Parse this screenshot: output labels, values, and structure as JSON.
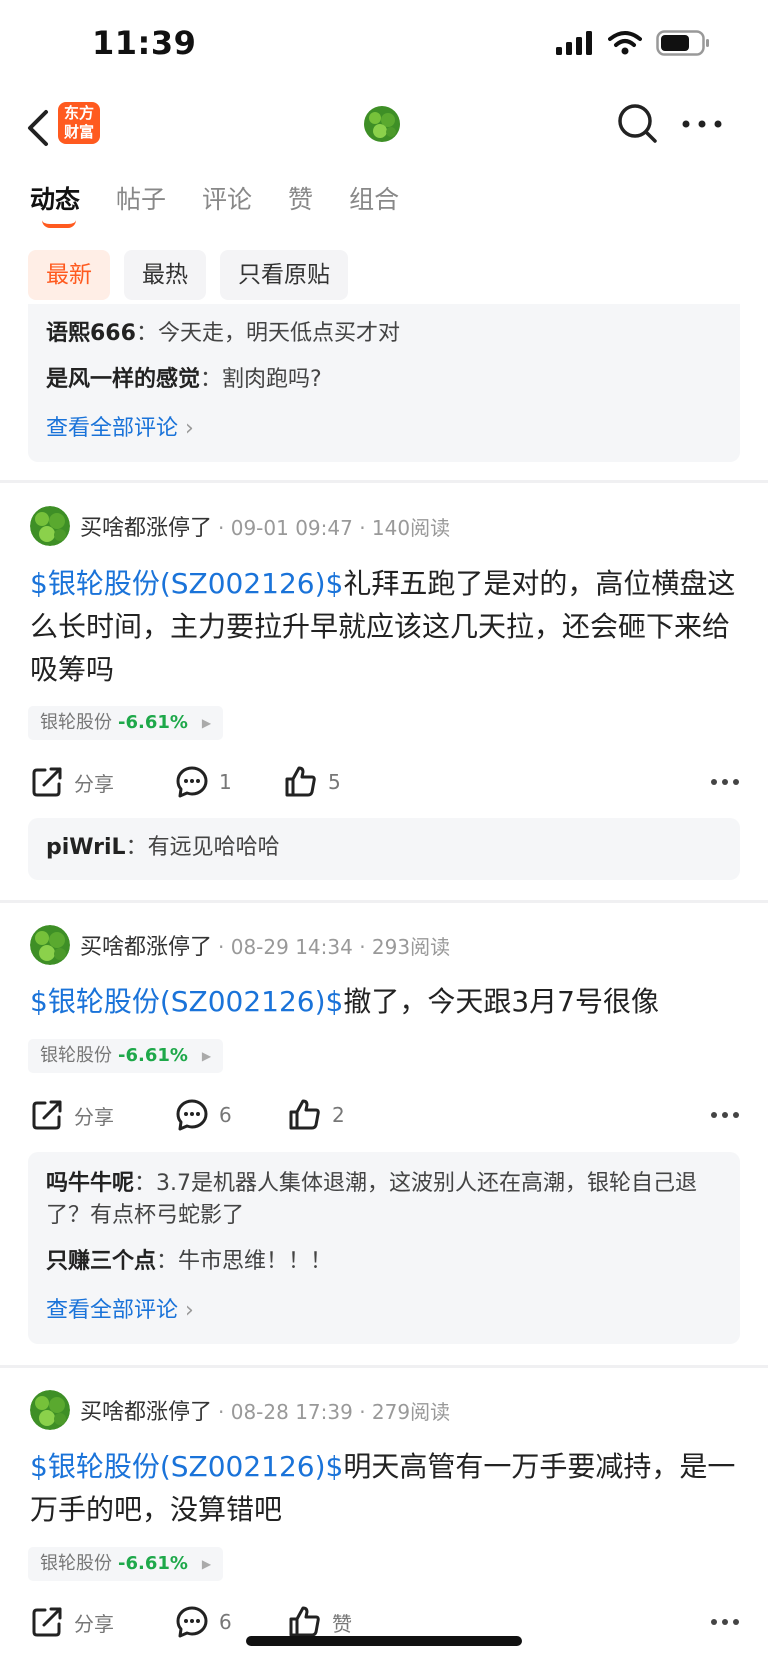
{
  "status": {
    "time": "11:39"
  },
  "app": {
    "logo_text": "东方财富"
  },
  "tabs": [
    {
      "label": "动态",
      "active": true
    },
    {
      "label": "帖子",
      "active": false
    },
    {
      "label": "评论",
      "active": false
    },
    {
      "label": "赞",
      "active": false
    },
    {
      "label": "组合",
      "active": false
    }
  ],
  "filters": [
    {
      "label": "最新",
      "active": true
    },
    {
      "label": "最热",
      "active": false
    },
    {
      "label": "只看原贴",
      "active": false
    }
  ],
  "top_comments": {
    "items": [
      {
        "author": "语熙666",
        "text": "今天走，明天低点买才对"
      },
      {
        "author": "是风一样的感觉",
        "text": "割肉跑吗?"
      }
    ],
    "view_all": "查看全部评论"
  },
  "posts": [
    {
      "author": "买啥都涨停了",
      "meta": "· 09-01 09:47 · 140阅读",
      "stock_link": "$银轮股份(SZ002126)$",
      "text": "礼拜五跑了是对的，高位横盘这么长时间，主力要拉升早就应该这几天拉，还会砸下来给吸筹吗",
      "tag": {
        "name": "银轮股份",
        "change": "-6.61%"
      },
      "share": "分享",
      "comments": "1",
      "likes": "5",
      "replies": [
        {
          "author": "piWriL",
          "text": "有远见哈哈哈"
        }
      ],
      "view_all": ""
    },
    {
      "author": "买啥都涨停了",
      "meta": "· 08-29 14:34 · 293阅读",
      "stock_link": "$银轮股份(SZ002126)$",
      "text": "撤了，今天跟3月7号很像",
      "tag": {
        "name": "银轮股份",
        "change": "-6.61%"
      },
      "share": "分享",
      "comments": "6",
      "likes": "2",
      "replies": [
        {
          "author": "吗牛牛呢",
          "text": "3.7是机器人集体退潮，这波别人还在高潮，银轮自己退了？有点杯弓蛇影了"
        },
        {
          "author": "只赚三个点",
          "text": "牛市思维！！！"
        }
      ],
      "view_all": "查看全部评论"
    },
    {
      "author": "买啥都涨停了",
      "meta": "· 08-28 17:39 · 279阅读",
      "stock_link": "$银轮股份(SZ002126)$",
      "text": "明天高管有一万手要减持，是一万手的吧，没算错吧",
      "tag": {
        "name": "银轮股份",
        "change": "-6.61%"
      },
      "share": "分享",
      "comments": "6",
      "likes": "赞"
    }
  ],
  "icons": {
    "back": "chevron-left-icon",
    "search": "search-icon",
    "more": "more-dots-icon",
    "share": "share-icon",
    "comment": "comment-icon",
    "like": "thumbs-up-icon"
  },
  "colors": {
    "accent": "#ff5a1f",
    "link": "#1a73d9",
    "down": "#1ea84a"
  }
}
